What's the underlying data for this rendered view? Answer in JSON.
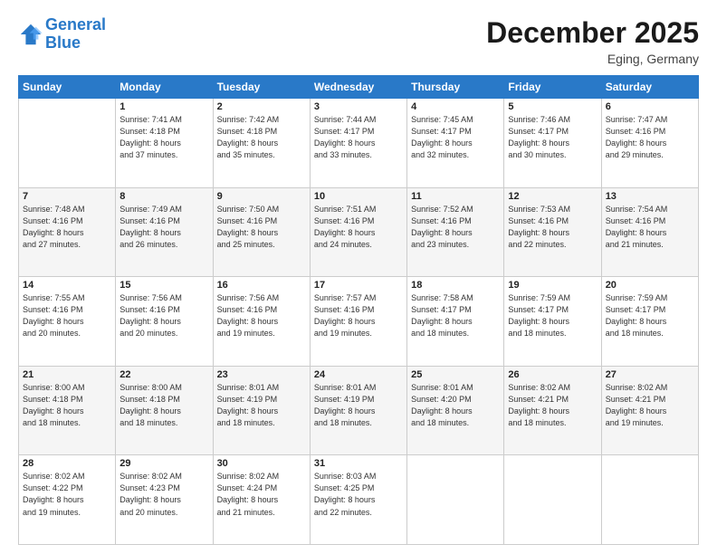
{
  "header": {
    "logo_line1": "General",
    "logo_line2": "Blue",
    "month_year": "December 2025",
    "location": "Eging, Germany"
  },
  "days_of_week": [
    "Sunday",
    "Monday",
    "Tuesday",
    "Wednesday",
    "Thursday",
    "Friday",
    "Saturday"
  ],
  "weeks": [
    [
      {
        "day": "",
        "info": ""
      },
      {
        "day": "1",
        "info": "Sunrise: 7:41 AM\nSunset: 4:18 PM\nDaylight: 8 hours\nand 37 minutes."
      },
      {
        "day": "2",
        "info": "Sunrise: 7:42 AM\nSunset: 4:18 PM\nDaylight: 8 hours\nand 35 minutes."
      },
      {
        "day": "3",
        "info": "Sunrise: 7:44 AM\nSunset: 4:17 PM\nDaylight: 8 hours\nand 33 minutes."
      },
      {
        "day": "4",
        "info": "Sunrise: 7:45 AM\nSunset: 4:17 PM\nDaylight: 8 hours\nand 32 minutes."
      },
      {
        "day": "5",
        "info": "Sunrise: 7:46 AM\nSunset: 4:17 PM\nDaylight: 8 hours\nand 30 minutes."
      },
      {
        "day": "6",
        "info": "Sunrise: 7:47 AM\nSunset: 4:16 PM\nDaylight: 8 hours\nand 29 minutes."
      }
    ],
    [
      {
        "day": "7",
        "info": "Sunrise: 7:48 AM\nSunset: 4:16 PM\nDaylight: 8 hours\nand 27 minutes."
      },
      {
        "day": "8",
        "info": "Sunrise: 7:49 AM\nSunset: 4:16 PM\nDaylight: 8 hours\nand 26 minutes."
      },
      {
        "day": "9",
        "info": "Sunrise: 7:50 AM\nSunset: 4:16 PM\nDaylight: 8 hours\nand 25 minutes."
      },
      {
        "day": "10",
        "info": "Sunrise: 7:51 AM\nSunset: 4:16 PM\nDaylight: 8 hours\nand 24 minutes."
      },
      {
        "day": "11",
        "info": "Sunrise: 7:52 AM\nSunset: 4:16 PM\nDaylight: 8 hours\nand 23 minutes."
      },
      {
        "day": "12",
        "info": "Sunrise: 7:53 AM\nSunset: 4:16 PM\nDaylight: 8 hours\nand 22 minutes."
      },
      {
        "day": "13",
        "info": "Sunrise: 7:54 AM\nSunset: 4:16 PM\nDaylight: 8 hours\nand 21 minutes."
      }
    ],
    [
      {
        "day": "14",
        "info": "Sunrise: 7:55 AM\nSunset: 4:16 PM\nDaylight: 8 hours\nand 20 minutes."
      },
      {
        "day": "15",
        "info": "Sunrise: 7:56 AM\nSunset: 4:16 PM\nDaylight: 8 hours\nand 20 minutes."
      },
      {
        "day": "16",
        "info": "Sunrise: 7:56 AM\nSunset: 4:16 PM\nDaylight: 8 hours\nand 19 minutes."
      },
      {
        "day": "17",
        "info": "Sunrise: 7:57 AM\nSunset: 4:16 PM\nDaylight: 8 hours\nand 19 minutes."
      },
      {
        "day": "18",
        "info": "Sunrise: 7:58 AM\nSunset: 4:17 PM\nDaylight: 8 hours\nand 18 minutes."
      },
      {
        "day": "19",
        "info": "Sunrise: 7:59 AM\nSunset: 4:17 PM\nDaylight: 8 hours\nand 18 minutes."
      },
      {
        "day": "20",
        "info": "Sunrise: 7:59 AM\nSunset: 4:17 PM\nDaylight: 8 hours\nand 18 minutes."
      }
    ],
    [
      {
        "day": "21",
        "info": "Sunrise: 8:00 AM\nSunset: 4:18 PM\nDaylight: 8 hours\nand 18 minutes."
      },
      {
        "day": "22",
        "info": "Sunrise: 8:00 AM\nSunset: 4:18 PM\nDaylight: 8 hours\nand 18 minutes."
      },
      {
        "day": "23",
        "info": "Sunrise: 8:01 AM\nSunset: 4:19 PM\nDaylight: 8 hours\nand 18 minutes."
      },
      {
        "day": "24",
        "info": "Sunrise: 8:01 AM\nSunset: 4:19 PM\nDaylight: 8 hours\nand 18 minutes."
      },
      {
        "day": "25",
        "info": "Sunrise: 8:01 AM\nSunset: 4:20 PM\nDaylight: 8 hours\nand 18 minutes."
      },
      {
        "day": "26",
        "info": "Sunrise: 8:02 AM\nSunset: 4:21 PM\nDaylight: 8 hours\nand 18 minutes."
      },
      {
        "day": "27",
        "info": "Sunrise: 8:02 AM\nSunset: 4:21 PM\nDaylight: 8 hours\nand 19 minutes."
      }
    ],
    [
      {
        "day": "28",
        "info": "Sunrise: 8:02 AM\nSunset: 4:22 PM\nDaylight: 8 hours\nand 19 minutes."
      },
      {
        "day": "29",
        "info": "Sunrise: 8:02 AM\nSunset: 4:23 PM\nDaylight: 8 hours\nand 20 minutes."
      },
      {
        "day": "30",
        "info": "Sunrise: 8:02 AM\nSunset: 4:24 PM\nDaylight: 8 hours\nand 21 minutes."
      },
      {
        "day": "31",
        "info": "Sunrise: 8:03 AM\nSunset: 4:25 PM\nDaylight: 8 hours\nand 22 minutes."
      },
      {
        "day": "",
        "info": ""
      },
      {
        "day": "",
        "info": ""
      },
      {
        "day": "",
        "info": ""
      }
    ]
  ]
}
